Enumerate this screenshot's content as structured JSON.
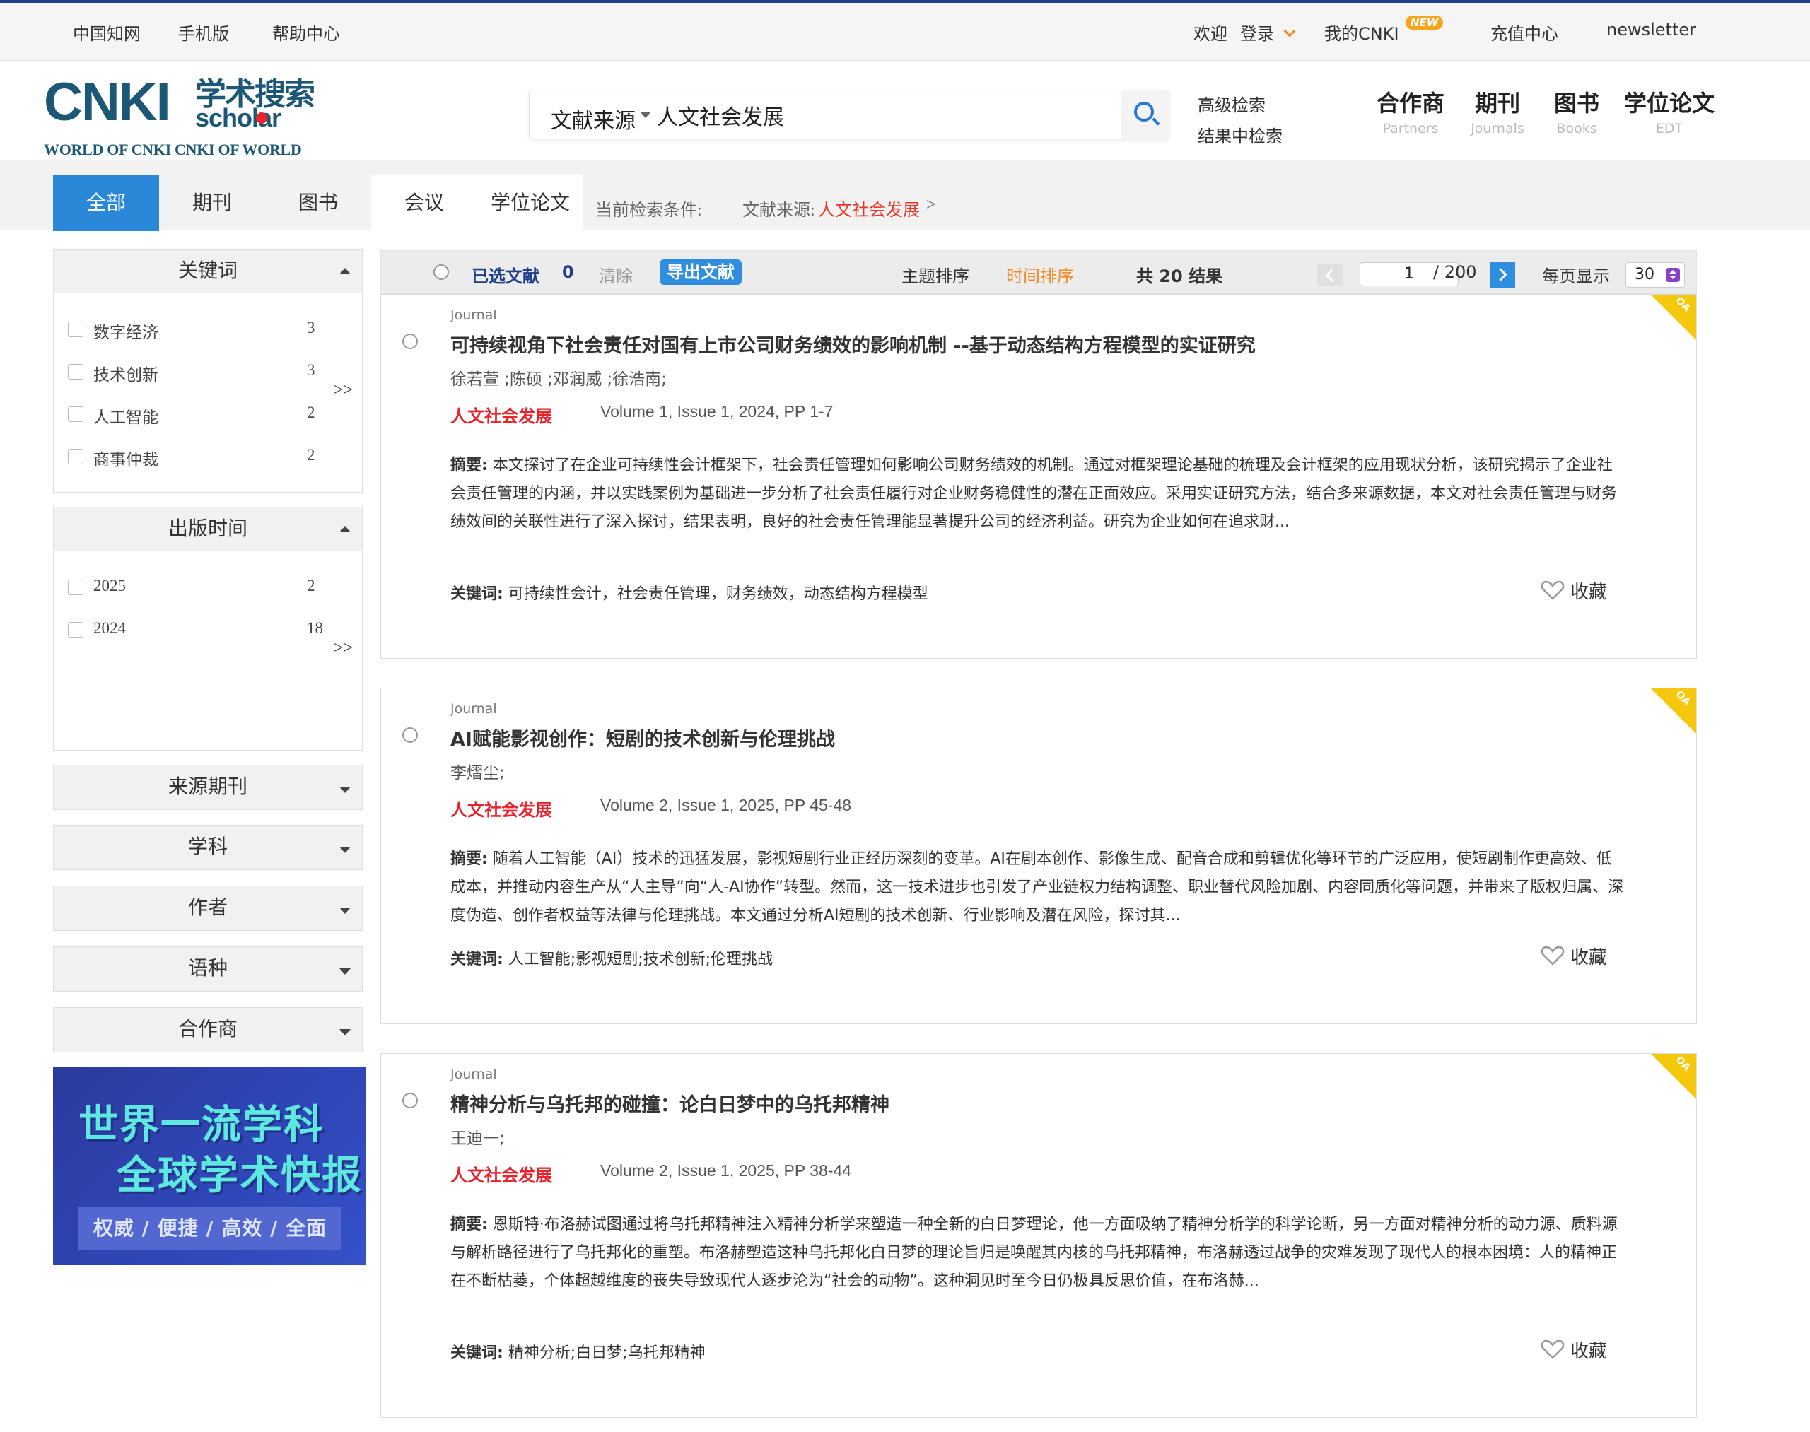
{
  "topbar": {
    "left_links": [
      "中国知网",
      "手机版",
      "帮助中心"
    ],
    "welcome": "欢迎",
    "login": "登录",
    "my_cnki": "我的CNKI",
    "new_badge": "NEW",
    "recharge": "充值中心",
    "newsletter": "newsletter"
  },
  "logo": {
    "mark": "CNKI",
    "cn": "学术搜索",
    "en": "scholar",
    "tagline": "WORLD OF CNKI CNKI OF WORLD"
  },
  "search": {
    "field": "文献来源",
    "query": "人文社会发展",
    "advanced": "高级检索",
    "within": "结果中检索"
  },
  "main_nav": [
    {
      "cn": "合作商",
      "en": "Partners"
    },
    {
      "cn": "期刊",
      "en": "Journals"
    },
    {
      "cn": "图书",
      "en": "Books"
    },
    {
      "cn": "学位论文",
      "en": "EDT"
    }
  ],
  "tabs": [
    "全部",
    "期刊",
    "图书",
    "会议",
    "学位论文"
  ],
  "condition": {
    "label": "当前检索条件:",
    "field": "文献来源:",
    "value": "人文社会发展",
    "arrow": ">"
  },
  "facets": {
    "keywords": {
      "title": "关键词",
      "items": [
        {
          "label": "数字经济",
          "count": "3"
        },
        {
          "label": "技术创新",
          "count": "3"
        },
        {
          "label": "人工智能",
          "count": "2"
        },
        {
          "label": "商事仲裁",
          "count": "2"
        }
      ],
      "more": ">>"
    },
    "pubtime": {
      "title": "出版时间",
      "items": [
        {
          "label": "2025",
          "count": "2"
        },
        {
          "label": "2024",
          "count": "18"
        }
      ],
      "more": ">>"
    },
    "collapsed": [
      "来源期刊",
      "学科",
      "作者",
      "语种",
      "合作商"
    ]
  },
  "banner": {
    "line1": "世界一流学科",
    "line2": "全球学术快报",
    "strip": "权威 / 便捷 / 高效 / 全面"
  },
  "toolbar": {
    "selected_label": "已选文献",
    "selected_count": "0",
    "clear": "清除",
    "export": "导出文献",
    "sort_topic": "主题排序",
    "sort_time": "时间排序",
    "total": "共 20 结果",
    "page": "1",
    "page_total": "/ 200",
    "per_page_label": "每页显示",
    "per_page": "30"
  },
  "results": [
    {
      "type": "Journal",
      "title": "可持续视角下社会责任对国有上市公司财务绩效的影响机制 --基于动态结构方程模型的实证研究",
      "authors": "徐若萱 ;陈硕 ;邓润威 ;徐浩南;",
      "source": "人文社会发展",
      "volume": "Volume 1, Issue 1, 2024, PP 1-7",
      "abstract_label": "摘要:",
      "abstract": " 本文探讨了在企业可持续性会计框架下，社会责任管理如何影响公司财务绩效的机制。通过对框架理论基础的梳理及会计框架的应用现状分析，该研究揭示了企业社会责任管理的内涵，并以实践案例为基础进一步分析了社会责任履行对企业财务稳健性的潜在正面效应。采用实证研究方法，结合多来源数据，本文对社会责任管理与财务绩效间的关联性进行了深入探讨，结果表明，良好的社会责任管理能显著提升公司的经济利益。研究为企业如何在追求财...",
      "kw_label": "关键词:",
      "keywords": " 可持续性会计，社会责任管理，财务绩效，动态结构方程模型",
      "fav": "收藏",
      "oa": "OA"
    },
    {
      "type": "Journal",
      "title": "AI赋能影视创作：短剧的技术创新与伦理挑战",
      "authors": "李熠尘;",
      "source": "人文社会发展",
      "volume": "Volume 2, Issue 1, 2025, PP 45-48",
      "abstract_label": "摘要:",
      "abstract": " 随着人工智能（AI）技术的迅猛发展，影视短剧行业正经历深刻的变革。AI在剧本创作、影像生成、配音合成和剪辑优化等环节的广泛应用，使短剧制作更高效、低成本，并推动内容生产从“人主导”向“人-AI协作”转型。然而，这一技术进步也引发了产业链权力结构调整、职业替代风险加剧、内容同质化等问题，并带来了版权归属、深度伪造、创作者权益等法律与伦理挑战。本文通过分析AI短剧的技术创新、行业影响及潜在风险，探讨其...",
      "kw_label": "关键词:",
      "keywords": " 人工智能;影视短剧;技术创新;伦理挑战",
      "fav": "收藏",
      "oa": "OA"
    },
    {
      "type": "Journal",
      "title": "精神分析与乌托邦的碰撞：论白日梦中的乌托邦精神",
      "authors": "王迪一;",
      "source": "人文社会发展",
      "volume": "Volume 2, Issue 1, 2025, PP 38-44",
      "abstract_label": "摘要:",
      "abstract": " 恩斯特·布洛赫试图通过将乌托邦精神注入精神分析学来塑造一种全新的白日梦理论，他一方面吸纳了精神分析学的科学论断，另一方面对精神分析的动力源、质料源与解析路径进行了乌托邦化的重塑。布洛赫塑造这种乌托邦化白日梦的理论旨归是唤醒其内核的乌托邦精神，布洛赫透过战争的灾难发现了现代人的根本困境：人的精神正在不断枯萎，个体超越维度的丧失导致现代人逐步沦为“社会的动物”。这种洞见时至今日仍极具反思价值，在布洛赫...",
      "kw_label": "关键词:",
      "keywords": " 精神分析;白日梦;乌托邦精神",
      "fav": "收藏",
      "oa": "OA"
    }
  ],
  "colors": {
    "accent_blue": "#2b88d8",
    "source_red": "#e8232b",
    "sort_orange": "#f08a24",
    "oa_yellow": "#f5c70d"
  }
}
